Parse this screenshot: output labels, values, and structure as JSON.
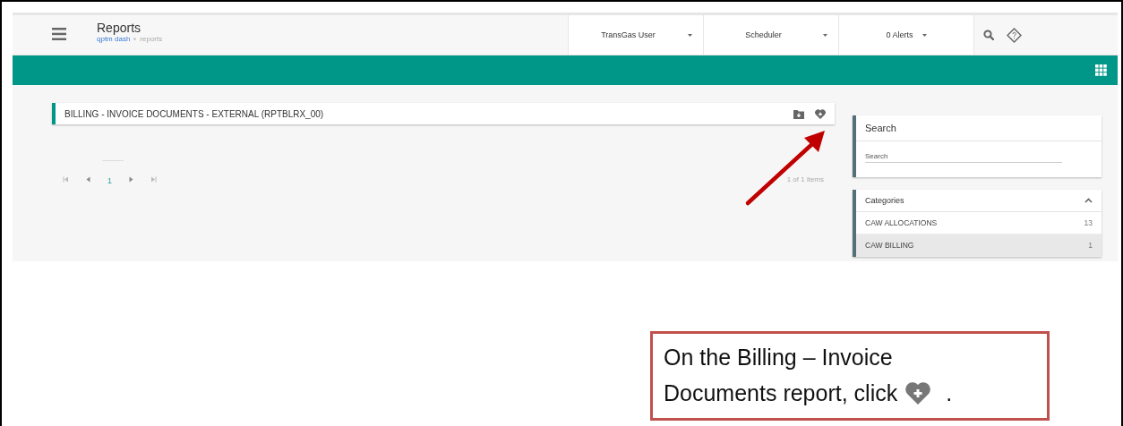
{
  "header": {
    "title": "Reports",
    "breadcrumb": [
      {
        "label": "qptm dash",
        "kind": "link"
      },
      {
        "label": "reports",
        "kind": "current"
      }
    ],
    "menus": [
      {
        "label": "TransGas User"
      },
      {
        "label": "Scheduler"
      },
      {
        "label": "0 Alerts"
      }
    ]
  },
  "report": {
    "title": "BILLING - INVOICE DOCUMENTS - EXTERNAL (RPTBLRX_00)"
  },
  "pager": {
    "pages": [
      {
        "label": "1",
        "selected": true
      }
    ],
    "summary": "1 of 1 items"
  },
  "search": {
    "title": "Search",
    "placeholder": "Search"
  },
  "categories": {
    "title": "Categories",
    "expanded": true,
    "items": [
      {
        "label": "CAW ALLOCATIONS",
        "count": "13",
        "selected": false
      },
      {
        "label": "CAW BILLING",
        "count": "1",
        "selected": true
      }
    ]
  },
  "callout": {
    "lines": [
      "On the Billing – Invoice",
      "Documents report, click"
    ],
    "end": "."
  }
}
